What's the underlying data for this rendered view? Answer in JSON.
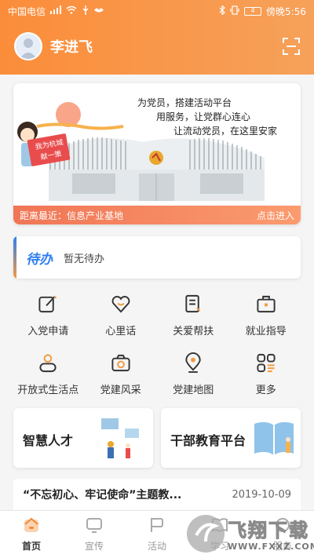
{
  "status_bar": {
    "carrier": "中国电信",
    "battery": "4",
    "time": "傍晚5:56"
  },
  "header": {
    "username": "李进飞",
    "avatar_icon": "user-avatar-icon",
    "scan_icon": "scan-icon"
  },
  "banner": {
    "slogans": [
      "为党员，搭建活动平台",
      "用服务，让党群心连心",
      "让流动党员，在这里安家"
    ],
    "badge_lines": [
      "我为杭城",
      "献一策"
    ],
    "distance_label": "距离最近：信息产业基地",
    "enter_label": "点击进入"
  },
  "todo": {
    "logo": "待办",
    "message": "暂无待办"
  },
  "grid": {
    "items": [
      {
        "label": "入党申请",
        "icon": "edit-icon"
      },
      {
        "label": "心里话",
        "icon": "heart-icon"
      },
      {
        "label": "关爱帮扶",
        "icon": "document-icon"
      },
      {
        "label": "就业指导",
        "icon": "briefcase-icon"
      },
      {
        "label": "开放式生活点",
        "icon": "person-icon"
      },
      {
        "label": "党建风采",
        "icon": "camera-icon"
      },
      {
        "label": "党建地图",
        "icon": "map-pin-icon"
      },
      {
        "label": "更多",
        "icon": "more-icon"
      }
    ]
  },
  "cards": {
    "talent": "智慧人才",
    "education": "干部教育平台"
  },
  "news": {
    "title": "“不忘初心、牢记使命”主题教...",
    "date": "2019-10-09"
  },
  "tabbar": {
    "tabs": [
      {
        "label": "首页",
        "icon": "home-icon"
      },
      {
        "label": "宣传",
        "icon": "monitor-icon"
      },
      {
        "label": "活动",
        "icon": "flag-icon"
      },
      {
        "label": "学习",
        "icon": "book-icon"
      },
      {
        "label": "服务",
        "icon": "service-icon"
      }
    ]
  },
  "watermark": {
    "brand": "飞翔下载",
    "url": "WWW.FXXZ.COM"
  },
  "colors": {
    "accent": "#fb8d3a",
    "banner_bar": "#f07656",
    "todo_blue": "#2f7ef0"
  }
}
